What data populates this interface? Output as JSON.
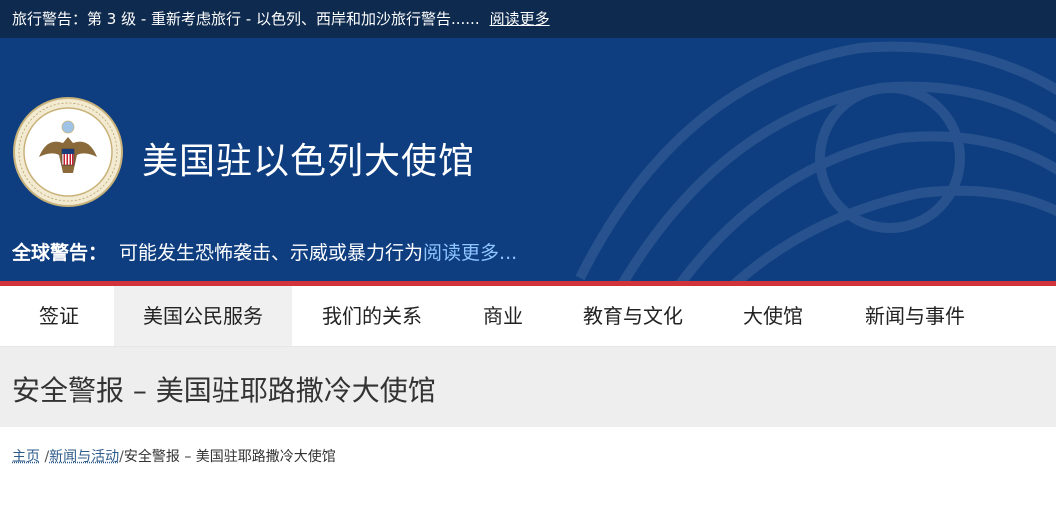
{
  "alert_bar": {
    "text": "旅行警告：第 3 级 - 重新考虑旅行 - 以色列、西岸和加沙旅行警告......",
    "more_label": "阅读更多"
  },
  "header": {
    "site_title": "美国驻以色列大使馆",
    "seal_text": "DEPARTMENT OF STATE · UNITED STATES OF AMERICA",
    "global_alert_label": "全球警告：",
    "global_alert_text": "可能发生恐怖袭击、示威或暴力行为",
    "global_alert_more": "阅读更多..."
  },
  "nav": {
    "items": [
      {
        "label": "签证"
      },
      {
        "label": "美国公民服务"
      },
      {
        "label": "我们的关系"
      },
      {
        "label": "商业"
      },
      {
        "label": "教育与文化"
      },
      {
        "label": "大使馆"
      },
      {
        "label": "新闻与事件"
      }
    ]
  },
  "page": {
    "title": "安全警报 – 美国驻耶路撒冷大使馆"
  },
  "breadcrumb": {
    "home": "主页",
    "sep": "/",
    "section": "新闻与活动",
    "current": "安全警报 – 美国驻耶路撒冷大使馆"
  },
  "colors": {
    "alert_bar": "#0e2a4e",
    "header_blue": "#0e3e80",
    "red_stripe": "#d0343a",
    "link_light": "#8ec5ff"
  }
}
